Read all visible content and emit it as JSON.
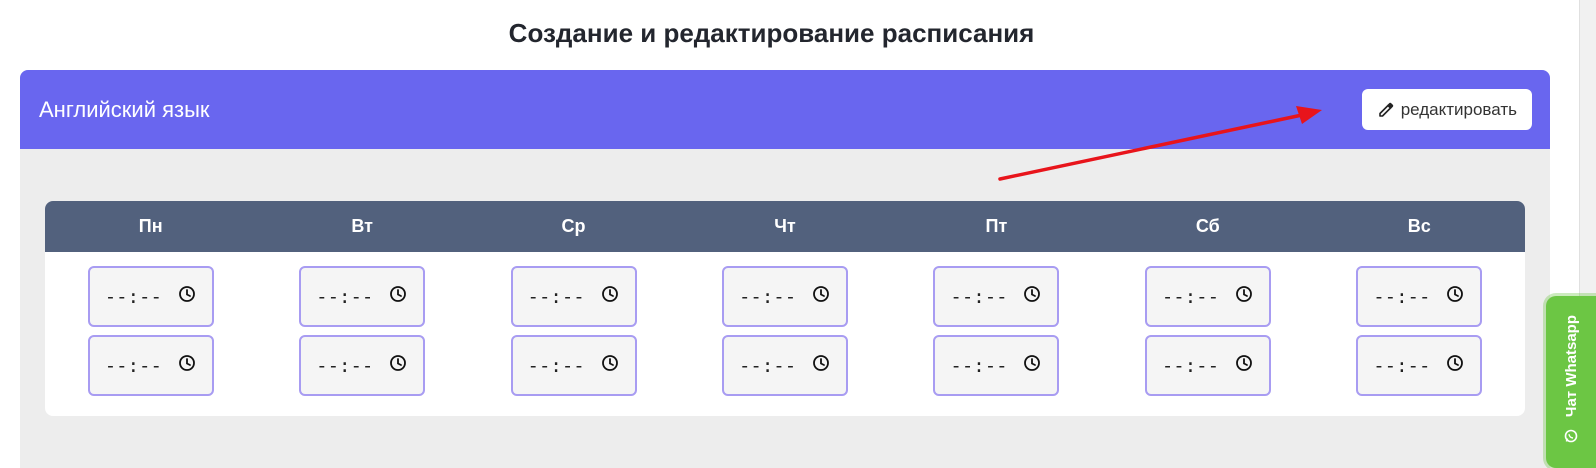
{
  "page": {
    "title": "Создание и редактирование расписания"
  },
  "card": {
    "title": "Английский язык",
    "edit_label": "редактировать",
    "header_color": "#6966ef"
  },
  "schedule": {
    "days": [
      {
        "label": "Пн",
        "slots": [
          "--:--",
          "--:--"
        ]
      },
      {
        "label": "Вт",
        "slots": [
          "--:--",
          "--:--"
        ]
      },
      {
        "label": "Ср",
        "slots": [
          "--:--",
          "--:--"
        ]
      },
      {
        "label": "Чт",
        "slots": [
          "--:--",
          "--:--"
        ]
      },
      {
        "label": "Пт",
        "slots": [
          "--:--",
          "--:--"
        ]
      },
      {
        "label": "Сб",
        "slots": [
          "--:--",
          "--:--"
        ]
      },
      {
        "label": "Вс",
        "slots": [
          "--:--",
          "--:--"
        ]
      }
    ],
    "header_color": "#52617d",
    "input_border_color": "#a89cf2"
  },
  "annotation": {
    "arrow_color": "#e8141b"
  },
  "whatsapp": {
    "label": "Чат Whatsapp",
    "color": "#6cc644"
  }
}
